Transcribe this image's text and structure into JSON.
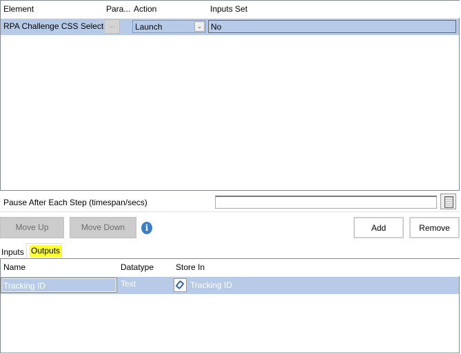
{
  "steps_grid": {
    "columns": [
      "Element",
      "Para...",
      "Action",
      "Inputs Set"
    ],
    "rows": [
      {
        "element": "RPA Challenge CSS Selector",
        "params_button": "...",
        "action": "Launch",
        "inputs_set": "No"
      }
    ]
  },
  "pause": {
    "label": "Pause After Each Step (timespan/secs)",
    "value": ""
  },
  "buttons": {
    "move_up": "Move Up",
    "move_down": "Move Down",
    "add": "Add",
    "remove": "Remove"
  },
  "tabs": [
    {
      "label": "Inputs"
    },
    {
      "label": "Outputs",
      "selected": true
    }
  ],
  "outputs_grid": {
    "columns": [
      "Name",
      "Datatype",
      "Store In"
    ],
    "rows": [
      {
        "name": "Tracking ID",
        "datatype": "Text",
        "store_in": "Tracking ID"
      }
    ]
  },
  "colors": {
    "selection": "#b7cbe8",
    "tab_highlight": "#ffff33",
    "info": "#3c7fc4"
  }
}
